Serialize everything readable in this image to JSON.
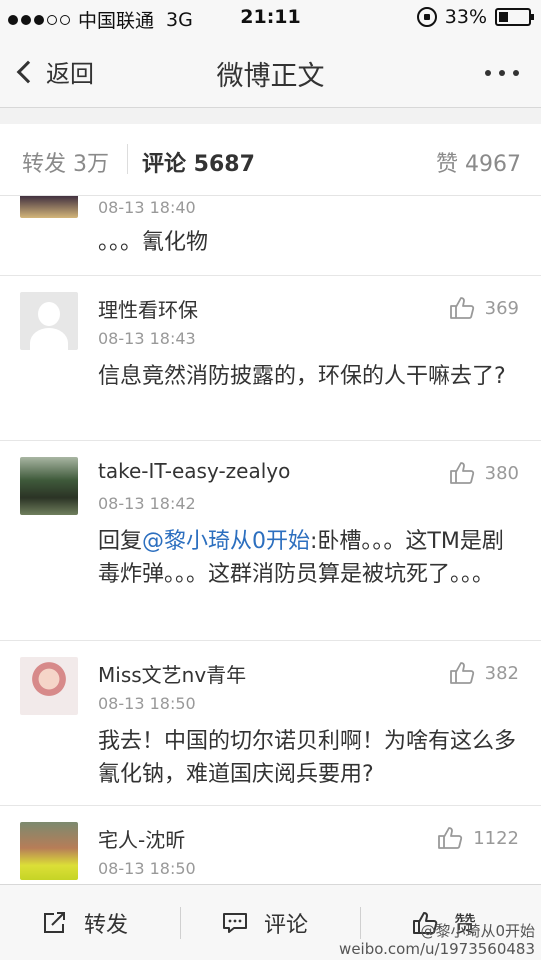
{
  "status_bar": {
    "carrier": "中国联通",
    "network": "3G",
    "time": "21:11",
    "battery": "33%",
    "battery_level": 0.33
  },
  "nav": {
    "back_label": "返回",
    "title": "微博正文"
  },
  "tabs": {
    "repost": "转发 3万",
    "comment": "评论 5687",
    "like": "赞 4967"
  },
  "comments": [
    {
      "time": "08-13 18:40",
      "text": "。。。氰化物"
    },
    {
      "name": "理性看环保",
      "time": "08-13 18:43",
      "likes": "369",
      "text": "信息竟然消防披露的，环保的人干嘛去了?"
    },
    {
      "name": "take-IT-easy-zealyo",
      "time": "08-13 18:42",
      "likes": "380",
      "reply_prefix": "回复",
      "mention": "@黎小琦从0开始",
      "text": ":卧槽。。。这TM是剧毒炸弹。。。这群消防员算是被坑死了。。。"
    },
    {
      "name": "Miss文艺nv青年",
      "time": "08-13 18:50",
      "likes": "382",
      "text": "我去！中国的切尔诺贝利啊！为啥有这么多氰化钠，难道国庆阅兵要用?"
    },
    {
      "name": "宅人-沈昕",
      "time": "08-13 18:50",
      "likes": "1122"
    }
  ],
  "toolbar": {
    "repost": "转发",
    "comment": "评论",
    "like": "赞"
  },
  "watermark": {
    "user": "@黎小琦从0开始",
    "url": "weibo.com/u/1973560483"
  }
}
